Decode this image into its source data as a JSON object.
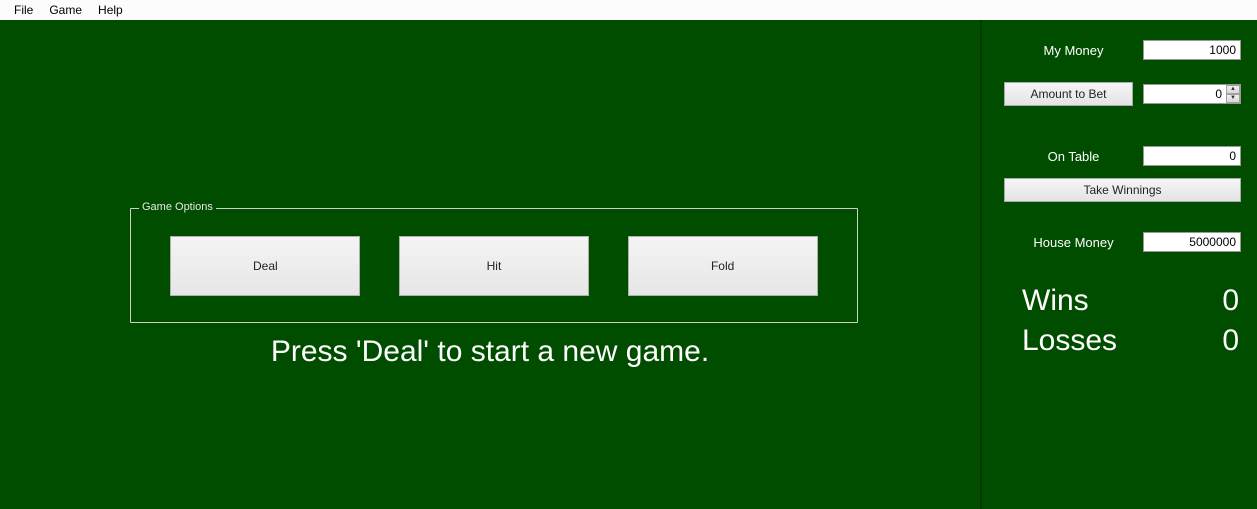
{
  "menubar": {
    "items": [
      {
        "label": "File"
      },
      {
        "label": "Game"
      },
      {
        "label": "Help"
      }
    ]
  },
  "game_options": {
    "legend": "Game Options",
    "buttons": {
      "deal": "Deal",
      "hit": "Hit",
      "fold": "Fold"
    }
  },
  "prompt": "Press 'Deal' to start a new game.",
  "sidebar": {
    "my_money": {
      "label": "My Money",
      "value": "1000"
    },
    "amount_to_bet": {
      "label": "Amount to Bet",
      "value": "0"
    },
    "on_table": {
      "label": "On Table",
      "value": "0"
    },
    "take_winnings": {
      "label": "Take Winnings"
    },
    "house_money": {
      "label": "House Money",
      "value": "5000000"
    },
    "wins": {
      "label": "Wins",
      "value": "0"
    },
    "losses": {
      "label": "Losses",
      "value": "0"
    }
  }
}
